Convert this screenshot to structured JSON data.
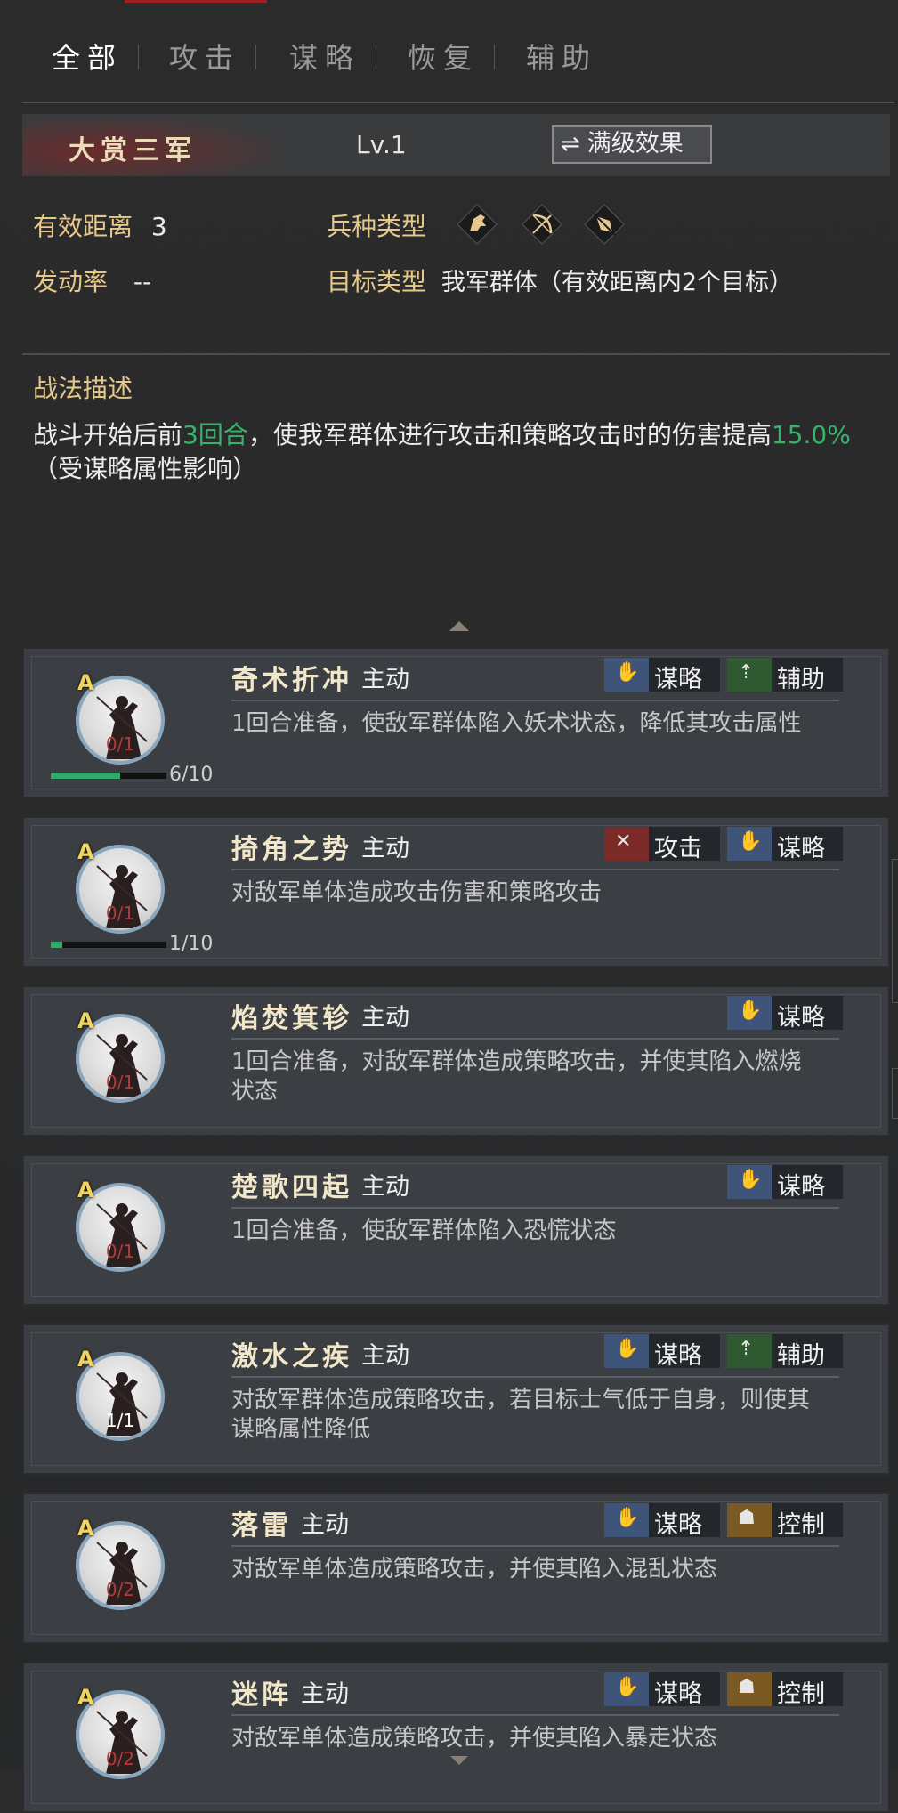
{
  "tabs": [
    {
      "label": "全部",
      "active": true
    },
    {
      "label": "攻击",
      "active": false
    },
    {
      "label": "谋略",
      "active": false
    },
    {
      "label": "恢复",
      "active": false
    },
    {
      "label": "辅助",
      "active": false
    }
  ],
  "skill": {
    "name": "大赏三军",
    "level": "Lv.1",
    "max_button": "满级效果",
    "distance_label": "有效距离",
    "distance_value": "3",
    "rate_label": "发动率",
    "rate_value": "--",
    "troop_label": "兵种类型",
    "troop_icons": [
      "cavalry-icon",
      "archer-icon",
      "spear-icon"
    ],
    "target_label": "目标类型",
    "target_value": "我军群体（有效距离内2个目标）",
    "desc_title": "战法描述",
    "desc_part1": "战斗开始后前",
    "desc_hl1": "3回合",
    "desc_part2": "，使我军群体进行攻击和策略攻击时的伤害提高",
    "desc_hl2": "15.0%",
    "desc_part3": "（受谋略属性影响）"
  },
  "colors": {
    "gold": "#e6c98a",
    "highlight_green": "#36b46a",
    "tag_mou": "#3e5579",
    "tag_fu": "#2f5a31",
    "tag_gong": "#7c2a28",
    "tag_kong": "#7a5a22"
  },
  "cards": [
    {
      "name": "奇术折冲",
      "type": "主动",
      "grade": "A",
      "count": "0/1",
      "progress_text": "6/10",
      "progress": 0.6,
      "tags": [
        {
          "label": "谋略",
          "kind": "mou"
        },
        {
          "label": "辅助",
          "kind": "fu"
        }
      ],
      "desc": "1回合准备，使敌军群体陷入妖术状态，降低其攻击属性"
    },
    {
      "name": "掎角之势",
      "type": "主动",
      "grade": "A",
      "count": "0/1",
      "progress_text": "1/10",
      "progress": 0.1,
      "tags": [
        {
          "label": "攻击",
          "kind": "gong"
        },
        {
          "label": "谋略",
          "kind": "mou"
        }
      ],
      "desc": "对敌军单体造成攻击伤害和策略攻击"
    },
    {
      "name": "焰焚箕轸",
      "type": "主动",
      "grade": "A",
      "count": "0/1",
      "tags": [
        {
          "label": "谋略",
          "kind": "mou"
        }
      ],
      "desc": "1回合准备，对敌军群体造成策略攻击，并使其陷入燃烧状态"
    },
    {
      "name": "楚歌四起",
      "type": "主动",
      "grade": "A",
      "count": "0/1",
      "tags": [
        {
          "label": "谋略",
          "kind": "mou"
        }
      ],
      "desc": "1回合准备，使敌军群体陷入恐慌状态"
    },
    {
      "name": "激水之疾",
      "type": "主动",
      "grade": "A",
      "count": "1/1",
      "tags": [
        {
          "label": "谋略",
          "kind": "mou"
        },
        {
          "label": "辅助",
          "kind": "fu"
        }
      ],
      "desc": "对敌军群体造成策略攻击，若目标士气低于自身，则使其谋略属性降低"
    },
    {
      "name": "落雷",
      "type": "主动",
      "grade": "A",
      "count": "0/2",
      "tags": [
        {
          "label": "谋略",
          "kind": "mou"
        },
        {
          "label": "控制",
          "kind": "kong"
        }
      ],
      "desc": "对敌军单体造成策略攻击，并使其陷入混乱状态"
    },
    {
      "name": "迷阵",
      "type": "主动",
      "grade": "A",
      "count": "0/2",
      "tags": [
        {
          "label": "谋略",
          "kind": "mou"
        },
        {
          "label": "控制",
          "kind": "kong"
        }
      ],
      "desc": "对敌军单体造成策略攻击，并使其陷入暴走状态"
    }
  ]
}
